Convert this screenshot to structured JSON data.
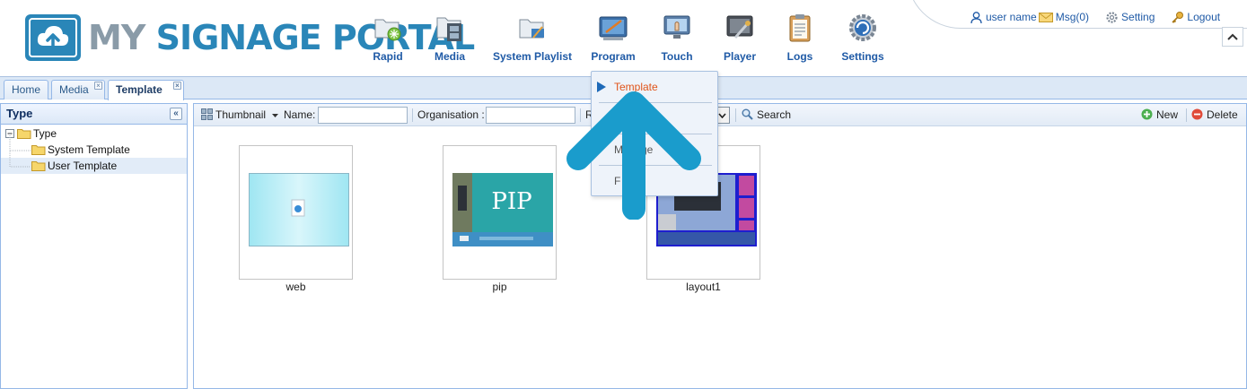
{
  "logo": {
    "text_my": "MY",
    "text_rest": "SIGNAGE PORTAL"
  },
  "nav": [
    {
      "label": "Rapid",
      "icon": "rapid-folder-icon"
    },
    {
      "label": "Media",
      "icon": "media-film-icon"
    },
    {
      "label": "System Playlist",
      "icon": "system-playlist-icon"
    },
    {
      "label": "Program",
      "icon": "program-board-icon"
    },
    {
      "label": "Touch",
      "icon": "touch-monitor-icon"
    },
    {
      "label": "Player",
      "icon": "player-tools-icon"
    },
    {
      "label": "Logs",
      "icon": "logs-clipboard-icon"
    },
    {
      "label": "Settings",
      "icon": "settings-gear-icon"
    }
  ],
  "user_nav": {
    "user": "user name",
    "msg": "Msg(0)",
    "setting": "Setting",
    "logout": "Logout"
  },
  "tabs": [
    {
      "label": "Home"
    },
    {
      "label": "Media"
    },
    {
      "label": "Template"
    }
  ],
  "left_panel": {
    "title": "Type",
    "tree": [
      {
        "label": "Type"
      },
      {
        "label": "System Template"
      },
      {
        "label": "User Template"
      }
    ]
  },
  "toolbar": {
    "view": "Thumbnail",
    "name_label": "Name:",
    "name_value": "",
    "org_label": "Organisation :",
    "org_value": "",
    "r_label": "R",
    "search": "Search",
    "new": "New",
    "delete": "Delete"
  },
  "thumbnails": [
    {
      "label": "web"
    },
    {
      "label": "pip",
      "preview_text": "PIP"
    },
    {
      "label": "layout1"
    }
  ],
  "dropdown": {
    "items": [
      {
        "label": "Template"
      },
      {
        "label": ""
      },
      {
        "label": "M      ge"
      },
      {
        "label": "F     n"
      }
    ]
  },
  "colors": {
    "accent": "#1f5aa6",
    "logo_blue": "#2a86b8",
    "arrow": "#1a9ccc",
    "active_menu": "#e0541a"
  }
}
